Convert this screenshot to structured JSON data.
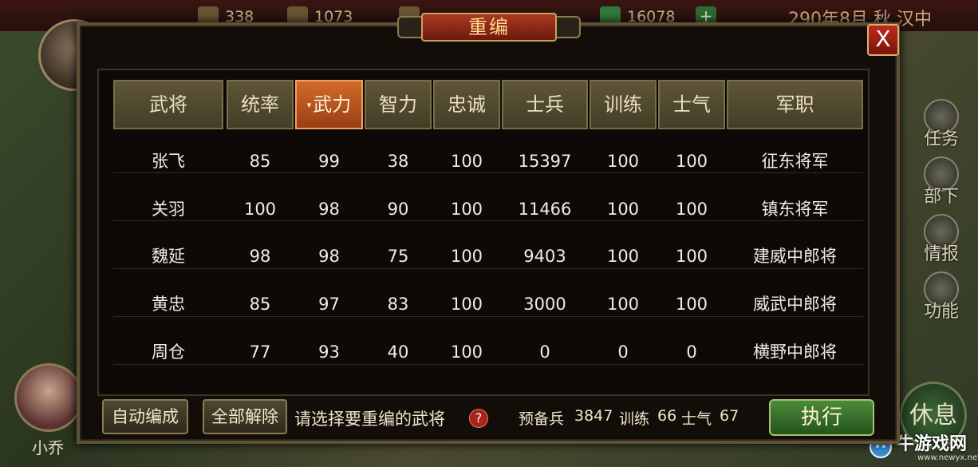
{
  "hud": {
    "resources": [
      "338",
      "1073",
      "16078"
    ],
    "plus_label": "+",
    "date": "290年8月 秋 汉中",
    "hero_name": "小乔",
    "side_menu": [
      "任务",
      "部下",
      "情报",
      "功能"
    ],
    "rest_label": "休息",
    "watermark": "牛游戏网",
    "watermark_url": "www.newyx.net"
  },
  "dialog": {
    "title": "重编",
    "close_label": "X",
    "columns": [
      "武将",
      "统率",
      "武力",
      "智力",
      "忠诚",
      "士兵",
      "训练",
      "士气",
      "军职"
    ],
    "active_column": "武力",
    "sort_marker": "▾",
    "rows": [
      [
        "张飞",
        "85",
        "99",
        "38",
        "100",
        "15397",
        "100",
        "100",
        "征东将军"
      ],
      [
        "关羽",
        "100",
        "98",
        "90",
        "100",
        "11466",
        "100",
        "100",
        "镇东将军"
      ],
      [
        "魏延",
        "98",
        "98",
        "75",
        "100",
        "9403",
        "100",
        "100",
        "建威中郎将"
      ],
      [
        "黄忠",
        "85",
        "97",
        "83",
        "100",
        "3000",
        "100",
        "100",
        "威武中郎将"
      ],
      [
        "周仓",
        "77",
        "93",
        "40",
        "100",
        "0",
        "0",
        "0",
        "横野中郎将"
      ]
    ],
    "auto_button": "自动编成",
    "release_button": "全部解除",
    "hint": "请选择要重编的武将",
    "help_label": "?",
    "stats": {
      "reserve_label": "预备兵",
      "reserve_value": "3847",
      "train_label": "训练",
      "train_value": "66",
      "morale_label": "士气",
      "morale_value": "67"
    },
    "execute_button": "执行"
  },
  "colors": {
    "active_header": "#d26a2a",
    "header": "#5e5638",
    "execute": "#4a8a3a",
    "close": "#c02a1a"
  }
}
